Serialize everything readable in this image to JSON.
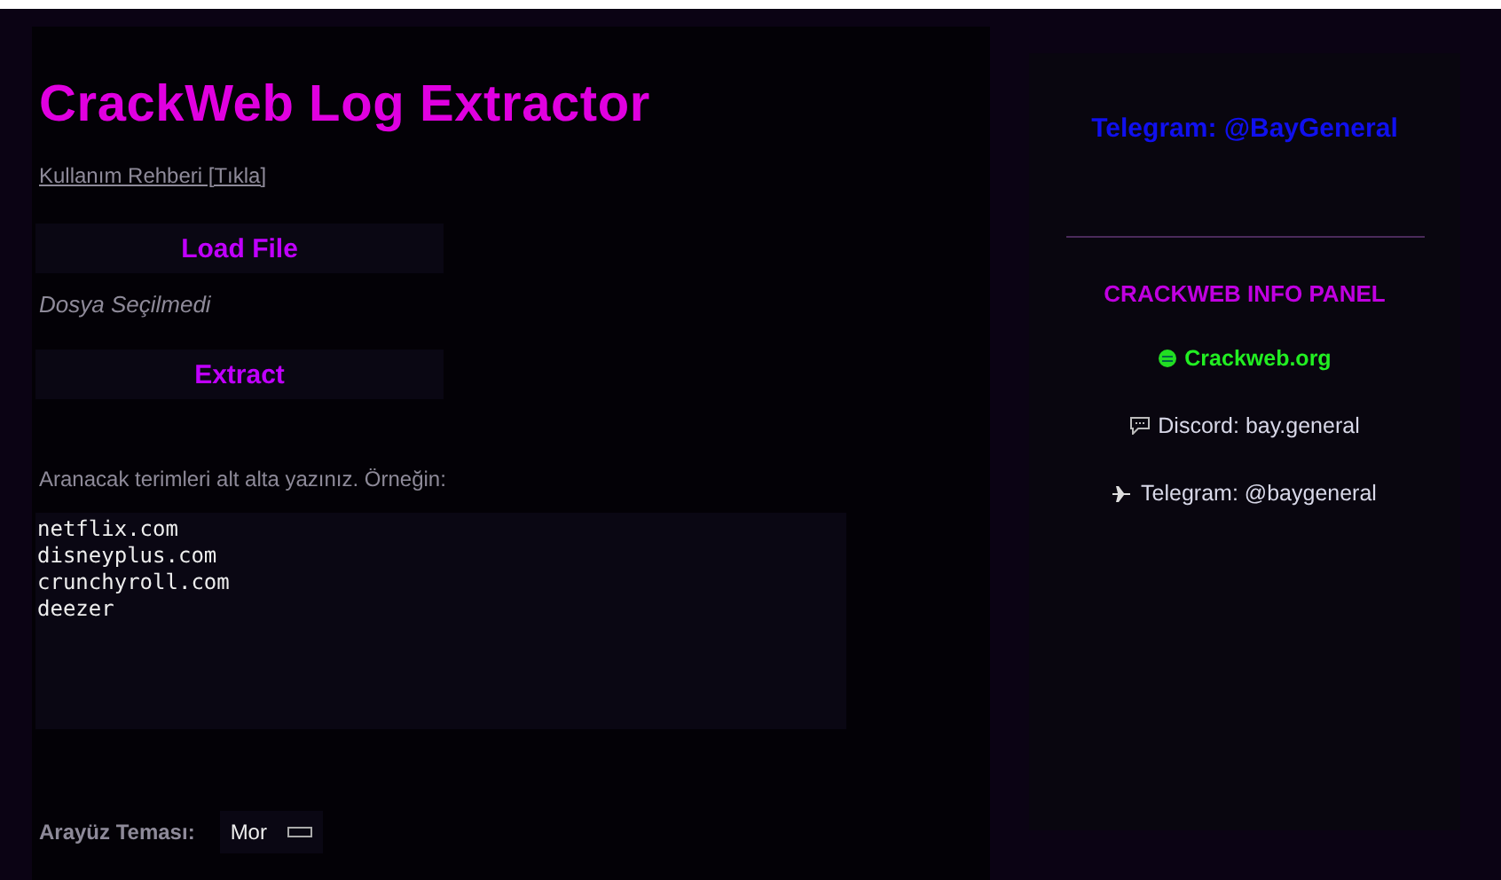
{
  "main": {
    "title": "CrackWeb Log Extractor",
    "guide_link": "Kullanım Rehberi [Tıkla]",
    "load_button": "Load File",
    "file_status": "Dosya Seçilmedi",
    "extract_button": "Extract",
    "terms_hint": "Aranacak terimleri alt alta yazınız. Örneğin:",
    "terms_value": "netflix.com\ndisneyplus.com\ncrunchyroll.com\ndeezer",
    "theme_label": "Arayüz Teması:",
    "theme_value": "Mor"
  },
  "info_panel": {
    "header": "Telegram: @BayGeneral",
    "title": "CRACKWEB INFO PANEL",
    "links": [
      {
        "kind": "web",
        "text": "Crackweb.org"
      },
      {
        "kind": "discord",
        "text": "Discord: bay.general"
      },
      {
        "kind": "telegram",
        "text": "Telegram: @baygeneral"
      }
    ]
  }
}
